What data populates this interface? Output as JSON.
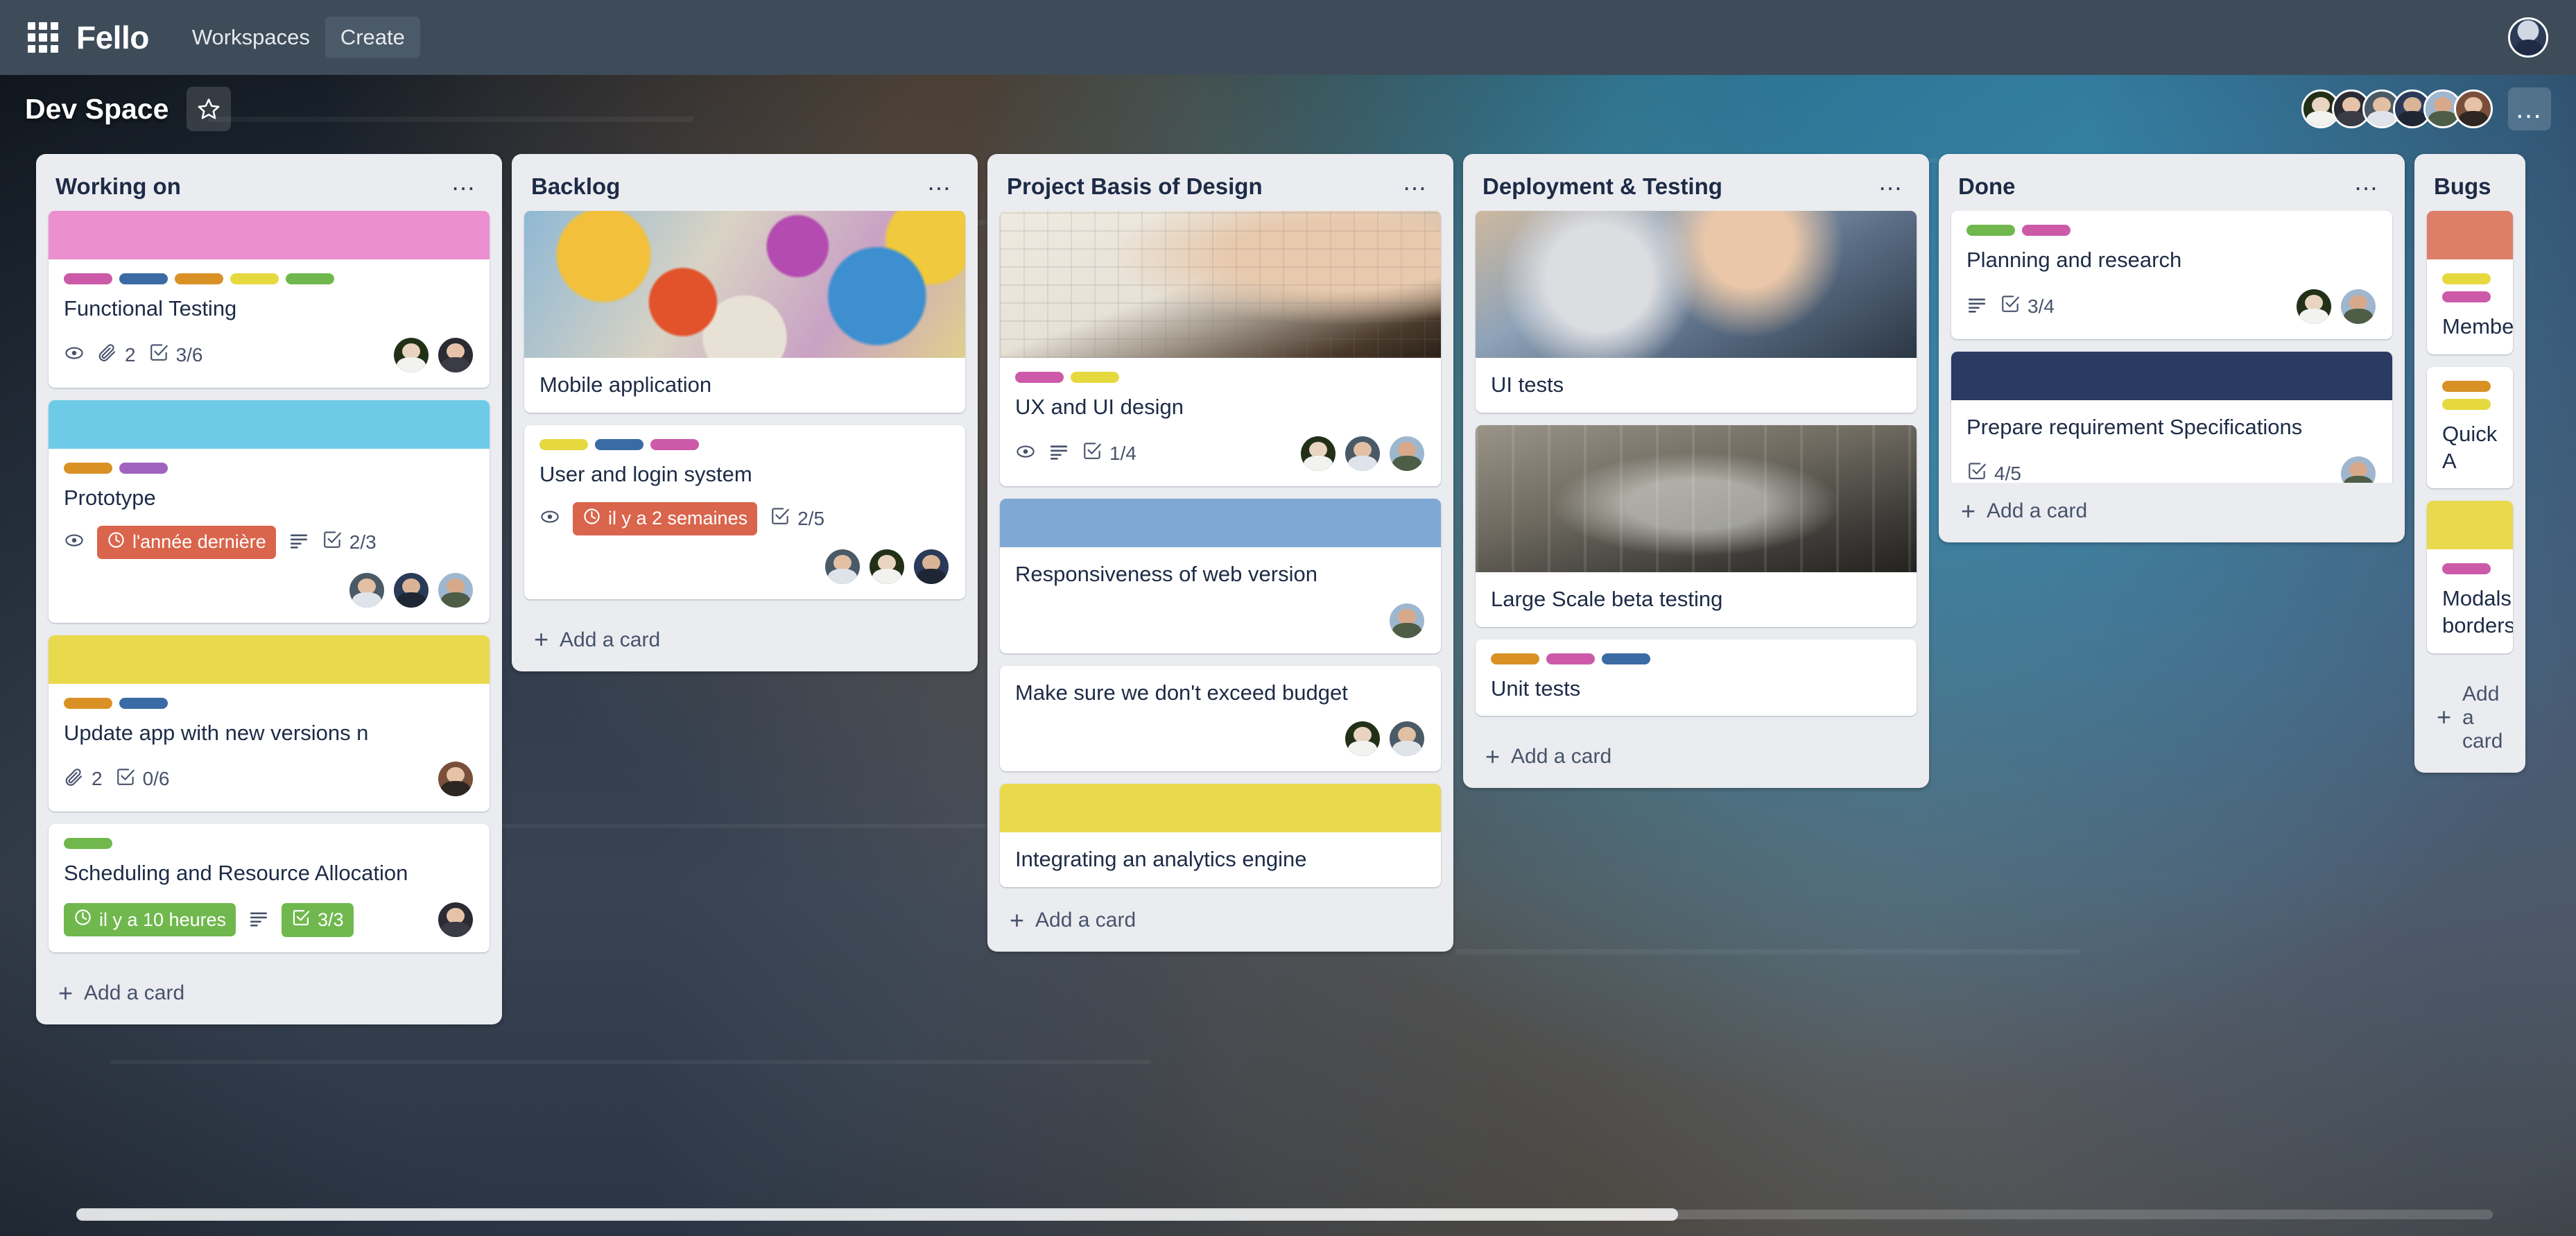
{
  "topnav": {
    "apps_icon": "grid-apps-icon",
    "brand": "Fello",
    "links": [
      {
        "label": "Workspaces",
        "boxed": false
      },
      {
        "label": "Create",
        "boxed": true
      }
    ],
    "account_avatar": "user-avatar"
  },
  "board": {
    "title": "Dev Space",
    "star_icon": "star-icon",
    "menu_icon": "ellipsis-icon",
    "members": [
      "member-1",
      "member-2",
      "member-3",
      "member-4",
      "member-5",
      "member-6"
    ]
  },
  "colors": {
    "label_pink": "#cc5aa8",
    "label_blue": "#3a6ba5",
    "label_orange": "#d99126",
    "label_yellow": "#e6d93f",
    "label_green": "#70b84d",
    "label_purple": "#a063c0",
    "cover_pink": "#ec8fd0",
    "cover_cyan": "#6ecbe8",
    "cover_yellow": "#e9da4d",
    "cover_blue_light": "#7fa9d4",
    "cover_navy": "#2b3a63",
    "cover_red": "#dd7e68",
    "due_overdue": "#d9654c",
    "due_ok": "#70b84d",
    "list_bg": "#ebecf0",
    "card_bg": "#ffffff",
    "nav_bg": "#3e4c59",
    "text_dark": "#1d2b46"
  },
  "add_card_label": "Add a card",
  "lists": [
    {
      "title": "Working on",
      "menu_icon": "ellipsis-icon",
      "add_card": "Add a card",
      "cards": [
        {
          "cover": "#ec8fd0",
          "cover_height": 70,
          "labels": [
            "#cc5aa8",
            "#3a6ba5",
            "#d99126",
            "#e6d93f",
            "#70b84d"
          ],
          "title": "Functional Testing",
          "badges": [
            {
              "type": "icon",
              "icon": "eye-icon"
            },
            {
              "type": "icon-text",
              "icon": "paperclip-icon",
              "text": "2"
            },
            {
              "type": "icon-text",
              "icon": "checklist-icon",
              "text": "3/6"
            }
          ],
          "avatars": [
            "member-1",
            "member-2"
          ]
        },
        {
          "cover": "#6ecbe8",
          "cover_height": 70,
          "labels": [
            "#d99126",
            "#a063c0"
          ],
          "title": "Prototype",
          "badges": [
            {
              "type": "icon",
              "icon": "eye-icon"
            },
            {
              "type": "due",
              "state": "overdue",
              "icon": "clock-icon",
              "text": "l'année dernière"
            },
            {
              "type": "icon",
              "icon": "description-icon"
            },
            {
              "type": "icon-text",
              "icon": "checklist-icon",
              "text": "2/3"
            }
          ],
          "avatars": [
            "member-3",
            "member-4",
            "member-5"
          ]
        },
        {
          "cover": "#e9da4d",
          "cover_height": 70,
          "labels": [
            "#d99126",
            "#3a6ba5"
          ],
          "title": "Update app with new versions n",
          "badges": [
            {
              "type": "icon-text",
              "icon": "paperclip-icon",
              "text": "2"
            },
            {
              "type": "icon-text",
              "icon": "checklist-icon",
              "text": "0/6"
            }
          ],
          "avatars": [
            "member-6"
          ]
        },
        {
          "cover": null,
          "labels": [
            "#70b84d"
          ],
          "title": "Scheduling and Resource Allocation",
          "badges": [
            {
              "type": "due",
              "state": "ok",
              "icon": "clock-icon",
              "text": "il y a 10 heures"
            },
            {
              "type": "icon",
              "icon": "description-icon"
            },
            {
              "type": "checklist-complete",
              "icon": "checklist-icon",
              "text": "3/3"
            }
          ],
          "avatars": [
            "member-2"
          ]
        }
      ]
    },
    {
      "title": "Backlog",
      "menu_icon": "ellipsis-icon",
      "add_card": "Add a card",
      "cards": [
        {
          "photo": "graffiti-phone-photo",
          "labels": [],
          "title": "Mobile application",
          "badges": [],
          "avatars": []
        },
        {
          "cover": null,
          "labels": [
            "#e6d93f",
            "#3a6ba5",
            "#cc5aa8"
          ],
          "title": "User and login system",
          "badges": [
            {
              "type": "icon",
              "icon": "eye-icon"
            },
            {
              "type": "due",
              "state": "overdue",
              "icon": "clock-icon",
              "text": "il y a 2 semaines"
            },
            {
              "type": "icon-text",
              "icon": "checklist-icon",
              "text": "2/5"
            }
          ],
          "avatars": [
            "member-3",
            "member-1",
            "member-4"
          ]
        }
      ]
    },
    {
      "title": "Project Basis of Design",
      "menu_icon": "ellipsis-icon",
      "add_card": "Add a card",
      "cards": [
        {
          "photo": "wireframe-sketch-photo",
          "labels": [
            "#cc5aa8",
            "#e6d93f"
          ],
          "title": "UX and UI design",
          "badges": [
            {
              "type": "icon",
              "icon": "eye-icon"
            },
            {
              "type": "icon",
              "icon": "description-icon"
            },
            {
              "type": "icon-text",
              "icon": "checklist-icon",
              "text": "1/4"
            }
          ],
          "avatars": [
            "member-1",
            "member-3",
            "member-5"
          ]
        },
        {
          "cover": "#7fa9d4",
          "cover_height": 70,
          "labels": [],
          "title": "Responsiveness of web version",
          "badges": [],
          "avatars": [
            "member-5"
          ]
        },
        {
          "cover": null,
          "labels": [],
          "title": "Make sure we don't exceed budget",
          "badges": [],
          "avatars": [
            "member-1",
            "member-3"
          ]
        },
        {
          "cover": "#e9da4d",
          "cover_height": 70,
          "labels": [],
          "title": "Integrating an analytics engine",
          "badges": [],
          "avatars": []
        }
      ]
    },
    {
      "title": "Deployment & Testing",
      "menu_icon": "ellipsis-icon",
      "add_card": "Add a card",
      "cards": [
        {
          "photo": "woman-phone-photo",
          "labels": [],
          "title": "UI tests",
          "badges": [],
          "avatars": []
        },
        {
          "photo": "data-wall-photo",
          "labels": [],
          "title": "Large Scale beta testing",
          "badges": [],
          "avatars": []
        },
        {
          "cover": null,
          "labels": [
            "#d99126",
            "#cc5aa8",
            "#3a6ba5"
          ],
          "title": "Unit tests",
          "badges": [],
          "avatars": []
        }
      ]
    },
    {
      "title": "Done",
      "menu_icon": "ellipsis-icon",
      "add_card": "Add a card",
      "cards": [
        {
          "cover": null,
          "labels": [
            "#70b84d",
            "#cc5aa8"
          ],
          "title": "Planning and research",
          "badges": [
            {
              "type": "icon",
              "icon": "description-icon"
            },
            {
              "type": "icon-text",
              "icon": "checklist-icon",
              "text": "3/4"
            }
          ],
          "avatars": [
            "member-1",
            "member-5"
          ]
        },
        {
          "cover": "#2b3a63",
          "cover_height": 70,
          "labels": [],
          "title": "Prepare requirement Specifications",
          "badges": [
            {
              "type": "icon-text",
              "icon": "checklist-icon",
              "text": "4/5"
            }
          ],
          "avatars": [
            "member-5"
          ]
        }
      ]
    },
    {
      "title": "Bugs",
      "menu_icon": "ellipsis-icon",
      "add_card": "Add a card",
      "truncated": true,
      "cards": [
        {
          "cover": "#dd7e68",
          "cover_height": 70,
          "labels": [
            "#e6d93f",
            "#cc5aa8"
          ],
          "title": "Members",
          "badges": [],
          "avatars": []
        },
        {
          "cover": null,
          "labels": [
            "#d99126",
            "#e6d93f"
          ],
          "title": "Quick A",
          "badges": [],
          "avatars": []
        },
        {
          "cover": "#e9da4d",
          "cover_height": 70,
          "labels": [
            "#cc5aa8"
          ],
          "title": "Modals borders",
          "badges": [],
          "avatars": []
        }
      ]
    }
  ]
}
